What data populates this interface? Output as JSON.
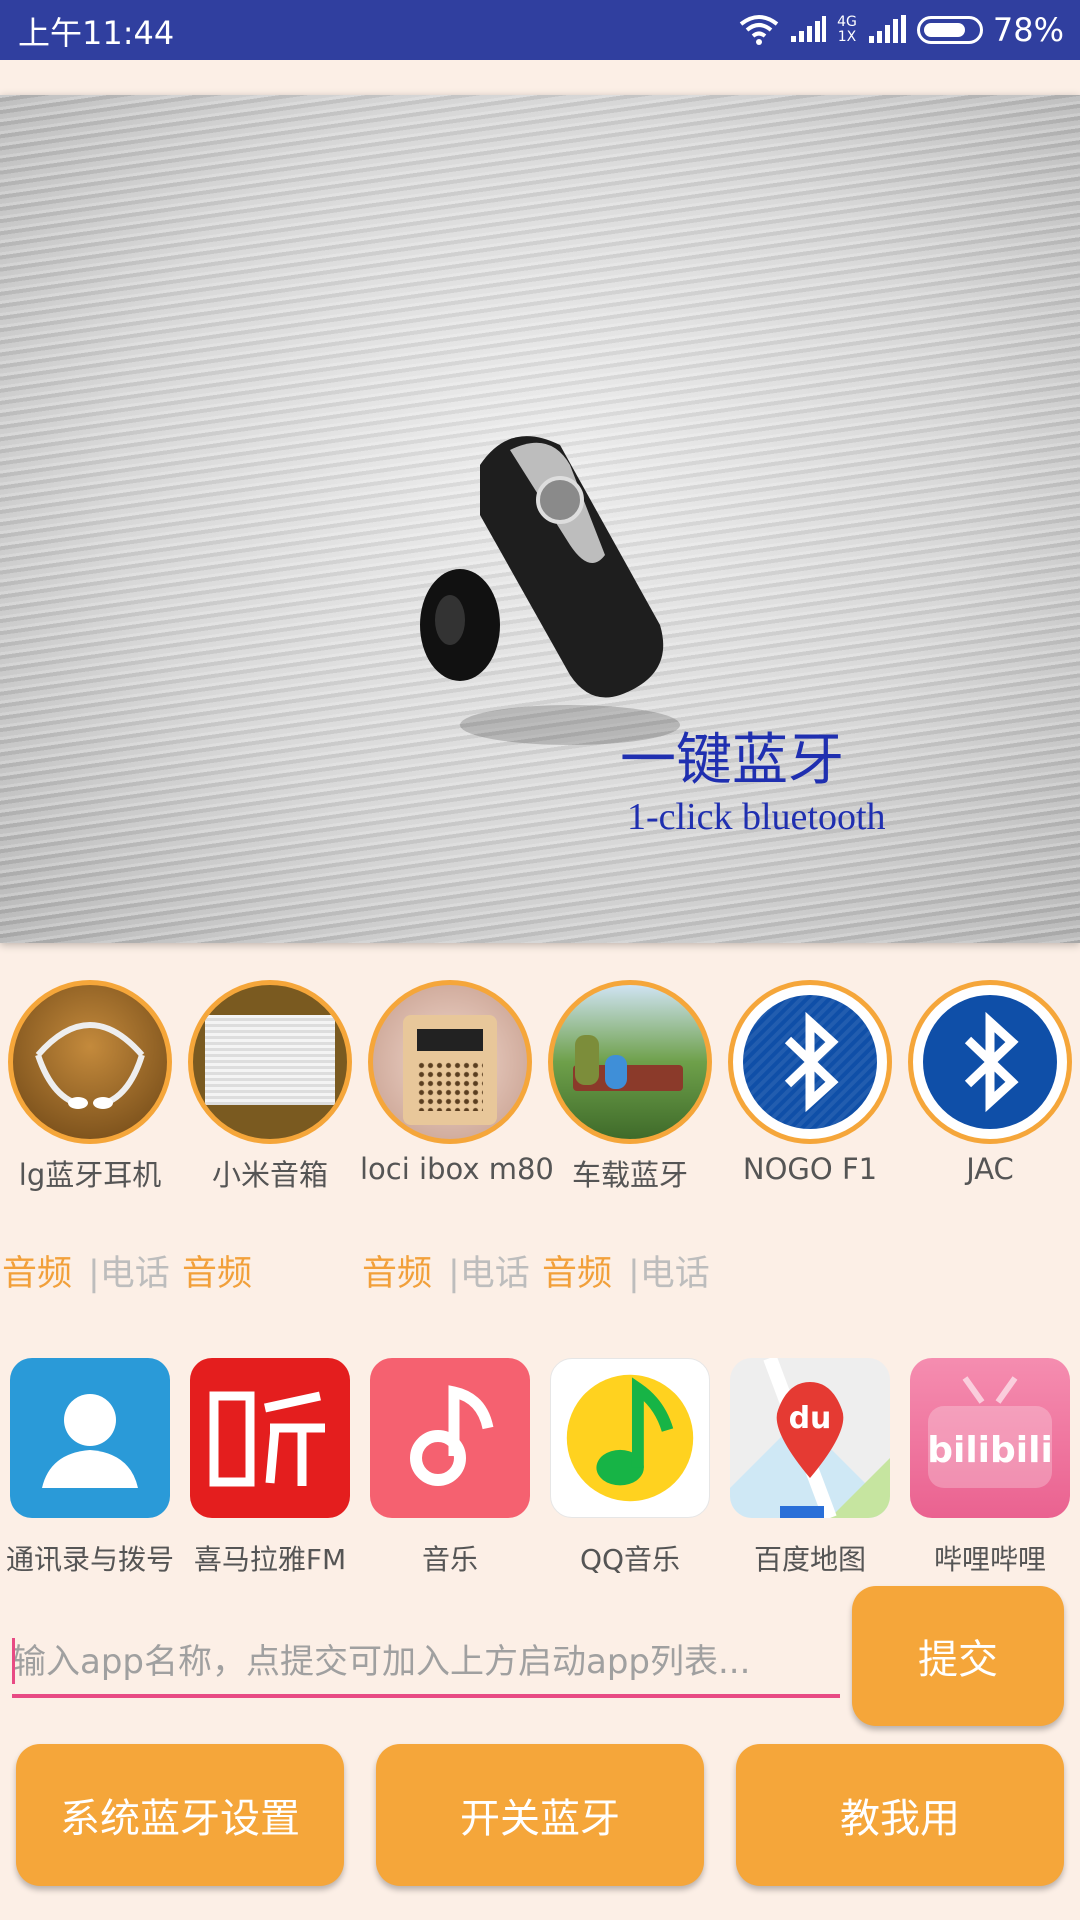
{
  "status": {
    "time": "上午11:44",
    "battery": "78%",
    "battery_level": 0.78,
    "net_top": "4G",
    "net_bottom": "1X"
  },
  "banner": {
    "title": "一键蓝牙",
    "subtitle": "1-click bluetooth"
  },
  "devices": [
    {
      "name": "lg蓝牙耳机",
      "icon": "headset-photo"
    },
    {
      "name": "小米音箱",
      "icon": "speaker-photo"
    },
    {
      "name": "loci ibox m80",
      "icon": "radio-photo"
    },
    {
      "name": "车载蓝牙",
      "icon": "family-photo"
    },
    {
      "name": "NOGO F1",
      "icon": "bluetooth-icon"
    },
    {
      "name": "JAC",
      "icon": "bluetooth-icon"
    }
  ],
  "device_tags": {
    "audio": "音频",
    "phone": "|电话"
  },
  "apps": [
    {
      "label": "通讯录与拨号",
      "icon": "contacts-icon",
      "color": "#2a9ad8"
    },
    {
      "label": "喜马拉雅FM",
      "icon": "ximalaya-icon",
      "color": "#e41e1e"
    },
    {
      "label": "音乐",
      "icon": "music-note-icon",
      "color": "#f56170"
    },
    {
      "label": "QQ音乐",
      "icon": "qq-music-icon",
      "color": "#ffffff"
    },
    {
      "label": "百度地图",
      "icon": "baidu-map-icon",
      "color": "#eeeeee"
    },
    {
      "label": "哔哩哔哩",
      "icon": "bilibili-icon",
      "color": "#f0739b"
    }
  ],
  "input": {
    "placeholder": "输入app名称，点提交可加入上方启动app列表..."
  },
  "buttons": {
    "submit": "提交",
    "bt_settings": "系统蓝牙设置",
    "toggle_bt": "开关蓝牙",
    "help": "教我用"
  },
  "colors": {
    "accent": "#f5a63a",
    "status_bar": "#303f9f",
    "background": "#fcefe6",
    "input_underline": "#e84a84"
  }
}
